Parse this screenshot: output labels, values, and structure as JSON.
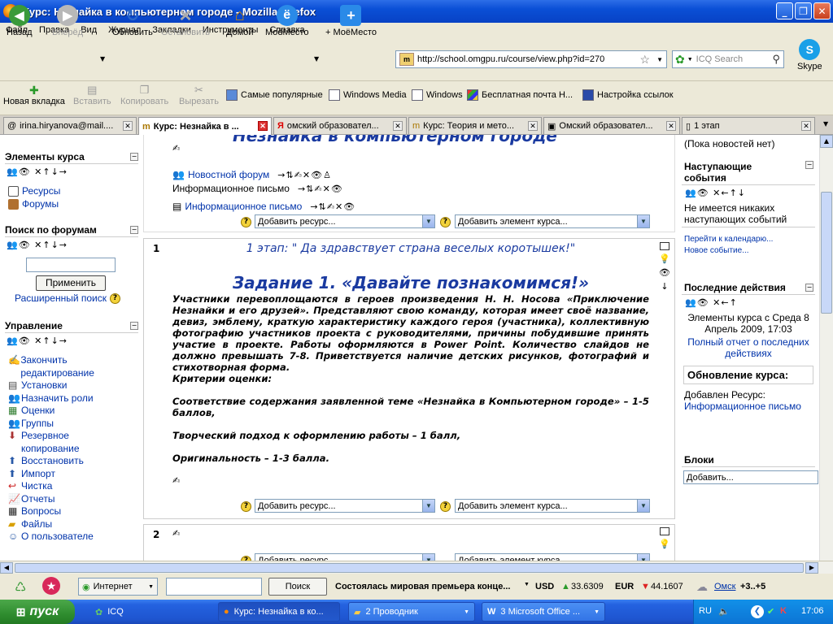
{
  "window": {
    "title": "Курс: Незнайка в компьютерном городе - Mozilla Firefox"
  },
  "menu": [
    "Файл",
    "Правка",
    "Вид",
    "Журнал",
    "Закладки",
    "Инструменты",
    "Справка"
  ],
  "nav": {
    "back": "Назад",
    "forward": "Вперёд",
    "reload": "Обновить",
    "stop": "Остановить",
    "home": "Домой",
    "myplace": "МоёМесто",
    "add_myplace": "+ МоёМесто",
    "skype": "Skype"
  },
  "address": {
    "url": "http://school.omgpu.ru/course/view.php?id=270"
  },
  "search": {
    "placeholder": "ICQ Search"
  },
  "bookmarks": {
    "new_tab": "Новая вкладка",
    "paste": "Вставить",
    "copy": "Копировать",
    "cut": "Вырезать",
    "items": [
      "Самые популярные",
      "Windows Media",
      "Windows",
      "Бесплатная почта H...",
      "Настройка ссылок"
    ]
  },
  "tabs": [
    "irina.hiryanova@mail....",
    "Курс: Незнайка в ...",
    "омский образовател...",
    "Курс: Теория и мето...",
    "Омский образовател...",
    "1 этап"
  ],
  "left": {
    "elements_title": "Элементы курса",
    "resources": "Ресурсы",
    "forums": "Форумы",
    "search_title": "Поиск по форумам",
    "apply": "Применить",
    "advanced": "Расширенный поиск",
    "manage_title": "Управление",
    "manage": [
      "Закончить редактирование",
      "Установки",
      "Назначить роли",
      "Оценки",
      "Группы",
      "Резервное копирование",
      "Восстановить",
      "Импорт",
      "Чистка",
      "Отчеты",
      "Вопросы",
      "Файлы",
      "О пользователе"
    ]
  },
  "center": {
    "top_heading": "Незнайка в компьютерном городе",
    "news_forum": "Новостной форум",
    "info_label": "Информационное письмо",
    "info_link": "Информационное письмо",
    "add_resource": "Добавить ресурс...",
    "add_activity": "Добавить элемент курса...",
    "section1_num": "1",
    "section1_title": "1 этап: \" Да здравствует страна веселых коротышек!\"",
    "task_title": "Задание 1. «Давайте познакомимся!»",
    "task_text": "Участники перевоплощаются в героев произведения Н. Н. Носова «Приключение Незнайки и его друзей». Представляют свою команду, которая имеет своё название, девиз, эмблему, краткую характеристику каждого героя (участника), коллективную фотографию участников проекта с руководителями, причины побудившие принять участие в проекте. Работы оформляются в Power Point. Количество слайдов не должно превышать 7-8. Приветствуется наличие детских рисунков, фотографий и стихотворная форма.",
    "criteria": "Критерии оценки:",
    "c1": "Соответствие содержания заявленной теме «Незнайка в Компьютерном городе» – 1-5 баллов,",
    "c2": "Творческий подход к оформлению работы – 1 балл,",
    "c3": "Оригинальность – 1-3 балла.",
    "section2_num": "2"
  },
  "right": {
    "no_news": "(Пока новостей нет)",
    "events_title": "Наступающие события",
    "no_events": "Не имеется никаких наступающих событий",
    "calendar": "Перейти к календарю...",
    "new_event": "Новое событие...",
    "recent_title": "Последние действия",
    "recent_text": "Элементы курса с Среда 8 Апрель 2009, 17:03",
    "full_report": "Полный отчет о последних действиях",
    "updates_title": "Обновление курса:",
    "added": "Добавлен Ресурс:",
    "added_link": "Информационное письмо",
    "blocks_title": "Блоки",
    "add_block": "Добавить..."
  },
  "status": {
    "internet": "Интернет",
    "search_btn": "Поиск",
    "news": "Состоялась мировая премьера конце...",
    "usd_label": "USD",
    "usd": "33.6309",
    "eur_label": "EUR",
    "eur": "44.1607",
    "city": "Омск",
    "temp": "+3..+5"
  },
  "taskbar": {
    "start": "пуск",
    "icq": "ICQ",
    "t1": "Курс: Незнайка в ко...",
    "t2": "2 Проводник",
    "t3": "3 Microsoft Office ...",
    "lang": "RU",
    "clock": "17:06"
  }
}
